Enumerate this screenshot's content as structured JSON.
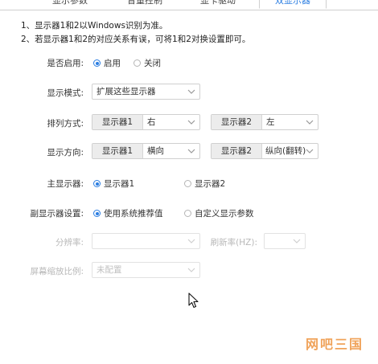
{
  "tabs": [
    {
      "label": "显示参数"
    },
    {
      "label": "音量控制"
    },
    {
      "label": "显卡驱动"
    },
    {
      "label": "双显示器"
    }
  ],
  "notes": [
    "1、显示器1和2以Windows识别为准。",
    "2、若显示器1和2的对应关系有误，可将1和2对换设置即可。"
  ],
  "enable": {
    "label": "是否启用:",
    "options": [
      "启用",
      "关闭"
    ],
    "selected": 0
  },
  "display_mode": {
    "label": "显示模式:",
    "value": "扩展这些显示器"
  },
  "arrangement": {
    "label": "排列方式:",
    "monitor1": {
      "prefix": "显示器1",
      "value": "右"
    },
    "monitor2": {
      "prefix": "显示器2",
      "value": "左"
    }
  },
  "orientation": {
    "label": "显示方向:",
    "monitor1": {
      "prefix": "显示器1",
      "value": "横向"
    },
    "monitor2": {
      "prefix": "显示器2",
      "value": "纵向(翻转)"
    }
  },
  "primary": {
    "label": "主显示器:",
    "options": [
      "显示器1",
      "显示器2"
    ],
    "selected": 0
  },
  "secondary_settings": {
    "label": "副显示器设置:",
    "options": [
      "使用系统推荐值",
      "自定义显示参数"
    ],
    "selected": 0
  },
  "resolution": {
    "label": "分辨率:",
    "value": ""
  },
  "refresh_rate": {
    "label": "刷新率(HZ):",
    "value": ""
  },
  "scaling": {
    "label": "屏幕缩放比例:",
    "value": "未配置"
  },
  "watermark": "网吧三国",
  "colors": {
    "accent": "#2a7de1",
    "watermark": "#f0a35a"
  }
}
